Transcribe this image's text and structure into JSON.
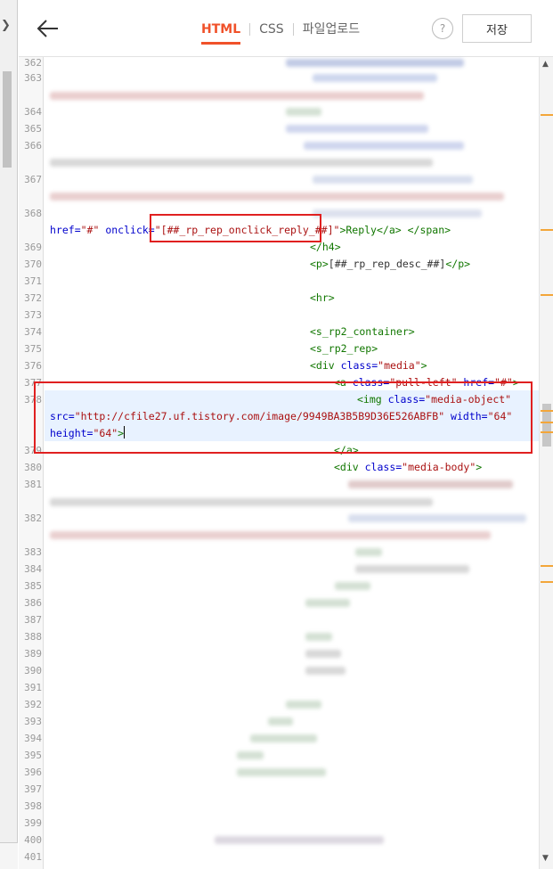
{
  "header": {
    "tabs": [
      {
        "label": "HTML"
      },
      {
        "label": "CSS"
      },
      {
        "label": "파일업로드"
      }
    ],
    "help_label": "?",
    "save_label": "저장"
  },
  "editor": {
    "line_numbers": [
      "362",
      "363",
      "364",
      "365",
      "366",
      "367",
      "368",
      "369",
      "370",
      "371",
      "372",
      "373",
      "374",
      "375",
      "376",
      "377",
      "378",
      "379",
      "380",
      "381",
      "382",
      "383",
      "384",
      "385",
      "386",
      "387",
      "388",
      "389",
      "390",
      "391",
      "392",
      "393",
      "394",
      "395",
      "396",
      "397",
      "398",
      "399",
      "400",
      "401"
    ],
    "code": {
      "l368": {
        "attr1": "href=",
        "str1": "\"#\"",
        "attr2": " onclick=",
        "str2": "\"[##_rp_rep_onclick_reply_##]\"",
        "rest": ">Reply</a> </span>"
      },
      "l369": "</h4>",
      "l370": {
        "open": "<p>",
        "text": "[##_rp_rep_desc_##]",
        "close": "</p>"
      },
      "l372": "<hr>",
      "l374": "<s_rp2_container>",
      "l375": "<s_rp2_rep>",
      "l376": {
        "open": "<div ",
        "attr": "class=",
        "str": "\"media\"",
        "close": ">"
      },
      "l377": {
        "open": "<a ",
        "attr1": "class=",
        "str1": "\"pull-left\"",
        "attr2": " href=",
        "str2": "\"#\"",
        "close": ">"
      },
      "l378a": {
        "open": "<img ",
        "attr": "class=",
        "str": "\"media-object\""
      },
      "l378b": {
        "attr1": "src=",
        "str1": "\"http://cfile27.uf.tistory.com/image/9949BA3B5B9D36E526ABFB\"",
        "attr2": " width=",
        "str2": "\"64\""
      },
      "l378c": {
        "attr": "height=",
        "str": "\"64\"",
        "close": ">"
      },
      "l379": "</a>",
      "l380": {
        "open": "<div ",
        "attr": "class=",
        "str": "\"media-body\"",
        "close": ">"
      }
    }
  },
  "icons": [
    "arrow-left-icon",
    "chevron-right-icon",
    "help-icon",
    "scroll-up-icon",
    "scroll-down-icon"
  ],
  "colors": {
    "accent": "#f0512a",
    "highlight_box": "#e02020",
    "tag": "#117700",
    "attr": "#0000cc",
    "string": "#aa1111"
  }
}
